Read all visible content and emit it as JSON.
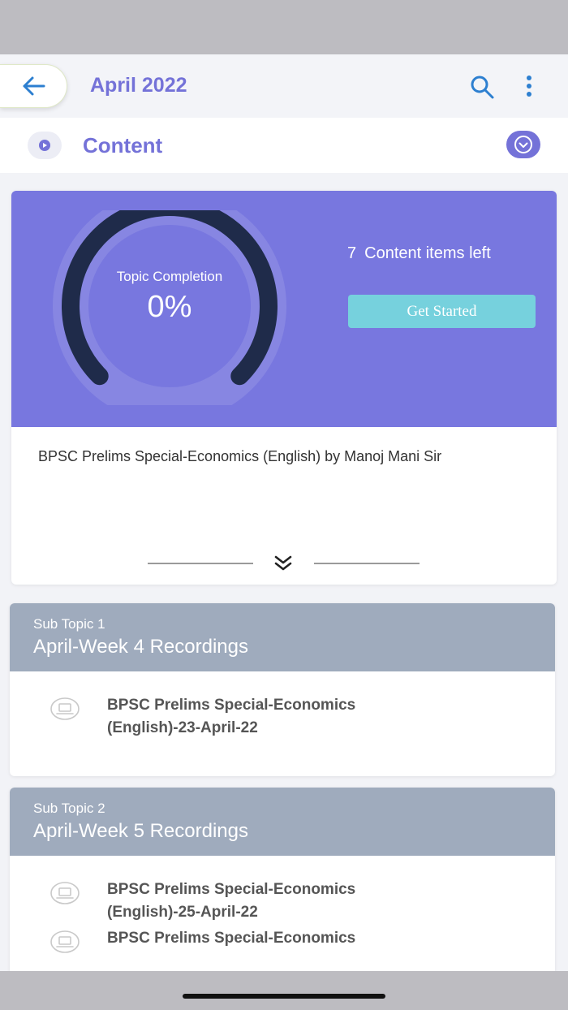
{
  "header": {
    "title": "April 2022",
    "back_icon": "arrow-left-icon",
    "search_icon": "search-icon",
    "more_icon": "more-vertical-icon"
  },
  "content_bar": {
    "title": "Content",
    "play_icon": "play-icon",
    "toggle_icon": "chevron-down-icon"
  },
  "topic": {
    "completion_label": "Topic Completion",
    "completion_value": "0%",
    "completion_fraction": 0,
    "items_left_count": "7",
    "items_left_label": "Content items left",
    "cta_label": "Get Started",
    "description": "BPSC Prelims Special-Economics (English) by Manoj Mani Sir",
    "expand_icon": "chevrons-down-icon"
  },
  "sub_topics": [
    {
      "number_label": "Sub Topic 1",
      "title": "April-Week 4 Recordings",
      "items": [
        {
          "title": "BPSC Prelims Special-Economics (English)-23-April-22",
          "icon": "laptop-icon"
        }
      ]
    },
    {
      "number_label": "Sub Topic 2",
      "title": "April-Week 5 Recordings",
      "items": [
        {
          "title": "BPSC Prelims Special-Economics (English)-25-April-22",
          "icon": "laptop-icon"
        },
        {
          "title": "BPSC Prelims Special-Economics",
          "icon": "laptop-icon"
        }
      ]
    }
  ],
  "colors": {
    "accent": "#7472d8",
    "banner": "#7877df",
    "cta": "#76d1dd",
    "subtopic_header": "#9fabbd",
    "gauge_track": "#1f2b4a"
  }
}
